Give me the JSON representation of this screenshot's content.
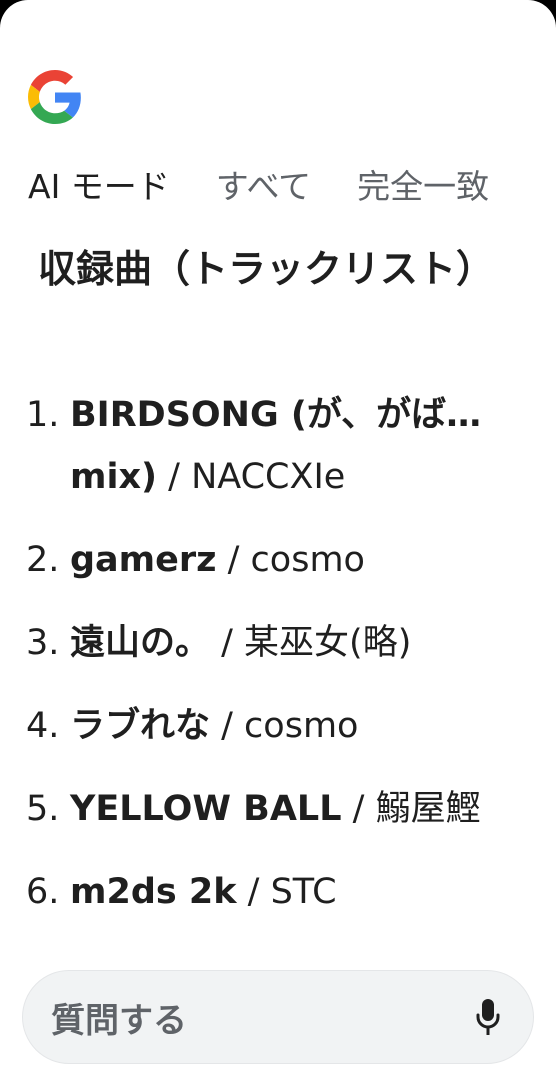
{
  "logo": {
    "icon": "google-g-icon"
  },
  "tabs": [
    {
      "label": "AI モード",
      "active": true
    },
    {
      "label": "すべて",
      "active": false
    },
    {
      "label": "完全一致",
      "active": false
    }
  ],
  "heading": "収録曲（トラックリスト）",
  "tracks": [
    {
      "num": "1.",
      "title": "BIRDSONG (が、がば… mix)",
      "artist": " / NACCXIe"
    },
    {
      "num": "2.",
      "title": "gamerz",
      "artist": " / cosmo"
    },
    {
      "num": "3.",
      "title": "遠山の。",
      "artist": " / 某巫女(略)"
    },
    {
      "num": "4.",
      "title": "ラブれな",
      "artist": " / cosmo"
    },
    {
      "num": "5.",
      "title": "YELLOW BALL",
      "artist": " / 鰯屋鰹"
    },
    {
      "num": "6.",
      "title": "m2ds 2k",
      "artist": " / STC"
    }
  ],
  "ask": {
    "placeholder": "質問する",
    "icon": "microphone-icon"
  }
}
